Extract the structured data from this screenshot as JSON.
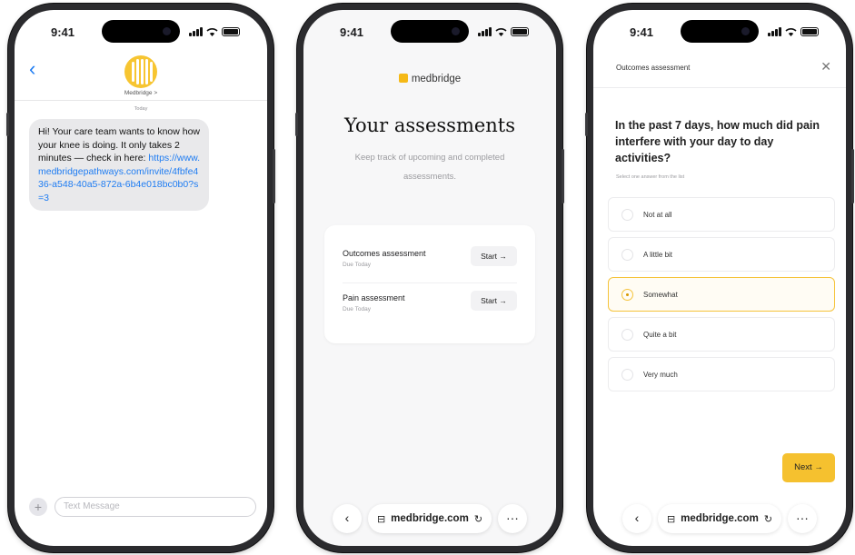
{
  "status_bar": {
    "time": "9:41"
  },
  "messages": {
    "contact_name": "Medbridge >",
    "date_label": "Today",
    "message_text": "Hi! Your care team wants to know how your knee is doing. It only takes 2 minutes — check in here:",
    "message_link": "https://www.medbridgepathways.com/invite/4fbfe436-a548-40a5-872a-6b4e018bc0b0?s=3",
    "compose_placeholder": "Text Message"
  },
  "assessments": {
    "brand": "medbridge",
    "title": "Your assessments",
    "subtitle": "Keep track of upcoming and completed assessments.",
    "items": [
      {
        "name": "Outcomes assessment",
        "due": "Due Today",
        "action": "Start →"
      },
      {
        "name": "Pain assessment",
        "due": "Due Today",
        "action": "Start →"
      }
    ]
  },
  "browser": {
    "url": "medbridge.com",
    "back_icon": "chevron-left-icon",
    "more_icon": "ellipsis-icon"
  },
  "survey": {
    "header_title": "Outcomes assessment",
    "question": "In the past 7 days, how much did pain interfere with your day to day activities?",
    "hint": "Select one answer from the list",
    "options": [
      "Not at all",
      "A little bit",
      "Somewhat",
      "Quite a bit",
      "Very much"
    ],
    "selected_index": 2,
    "next_label": "Next →"
  },
  "colors": {
    "accent": "#f5c12f",
    "link": "#1e7cf2",
    "bubble": "#e9e9eb"
  }
}
